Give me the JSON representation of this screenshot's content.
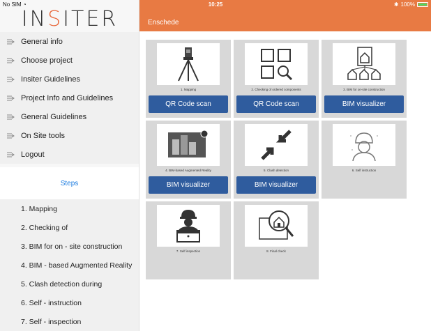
{
  "status": {
    "carrier": "No SIM",
    "time": "10:25",
    "battery": "100%"
  },
  "logo": {
    "part1": "IN",
    "accent": "S",
    "part2": "ITER"
  },
  "menu": [
    {
      "label": "General info"
    },
    {
      "label": "Choose project"
    },
    {
      "label": "Insiter Guidelines"
    },
    {
      "label": "Project Info and Guidelines"
    },
    {
      "label": "General Guidelines"
    },
    {
      "label": "On Site tools"
    },
    {
      "label": "Logout"
    }
  ],
  "steps_heading": "Steps",
  "steps": [
    "1. Mapping",
    "2. Checking of",
    "3. BIM for on - site construction",
    "4. BIM - based Augmented Reality",
    "5. Clash detection during",
    "6. Self - instruction",
    "7. Self - inspection"
  ],
  "header": {
    "title": "Enschede"
  },
  "cards": [
    {
      "caption": "1. Mapping",
      "button": "QR Code scan",
      "icon": "survey-tripod-icon"
    },
    {
      "caption": "2. Checking of ordered components",
      "button": "QR Code scan",
      "icon": "grid-search-icon"
    },
    {
      "caption": "3. BIM for on-site construction",
      "button": "BIM visualizer",
      "icon": "house-plan-icon"
    },
    {
      "caption": "4. BIM-based Augmented Reality",
      "button": "BIM visualizer",
      "icon": "ar-model-icon"
    },
    {
      "caption": "5. Clash detection",
      "button": "BIM visualizer",
      "icon": "clash-arrows-icon"
    },
    {
      "caption": "6. Self instruction",
      "button": "",
      "icon": "worker-helmet-icon"
    },
    {
      "caption": "7. Self inspection",
      "button": "",
      "icon": "worker-laptop-icon"
    },
    {
      "caption": "8. Final check",
      "button": "",
      "icon": "house-magnifier-icon"
    }
  ],
  "colors": {
    "header": "#e87a43",
    "button": "#2f5c9e",
    "link": "#1a7be0",
    "card": "#d8d8d8"
  }
}
